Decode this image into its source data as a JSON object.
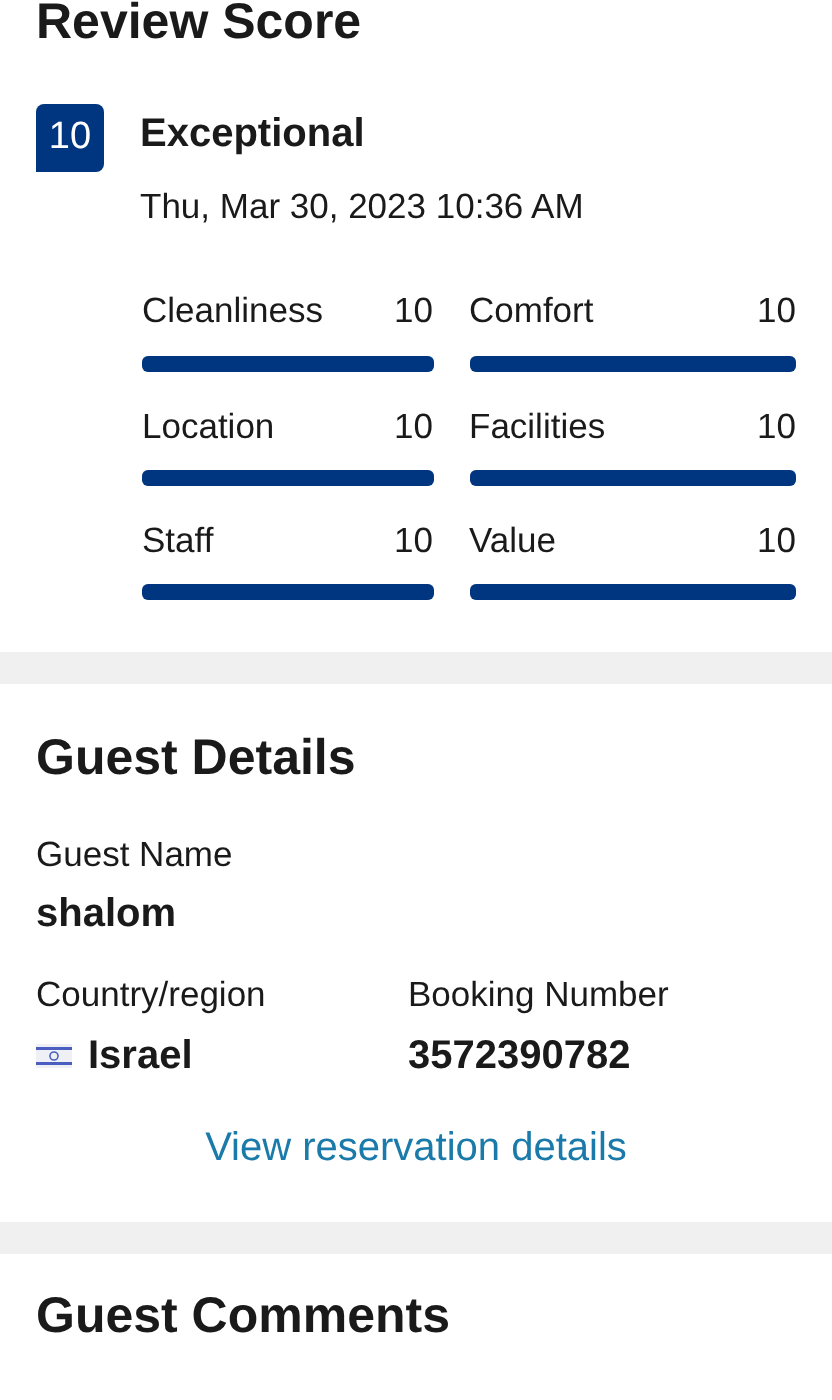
{
  "review_score": {
    "title": "Review Score",
    "score": "10",
    "rating": "Exceptional",
    "date": "Thu, Mar 30, 2023 10:36 AM",
    "categories": [
      {
        "name": "Cleanliness",
        "score": "10",
        "level": 1
      },
      {
        "name": "Comfort",
        "score": "10",
        "level": 1
      },
      {
        "name": "Location",
        "score": "10",
        "level": 1
      },
      {
        "name": "Facilities",
        "score": "10",
        "level": 1
      },
      {
        "name": "Staff",
        "score": "10",
        "level": 1
      },
      {
        "name": "Value",
        "score": "10",
        "level": 1
      }
    ]
  },
  "guest_details": {
    "title": "Guest Details",
    "guest_name_label": "Guest Name",
    "guest_name": "shalom",
    "country_label": "Country/region",
    "country": "Israel",
    "booking_label": "Booking Number",
    "booking_number": "3572390782",
    "link": "View reservation details"
  },
  "guest_comments": {
    "title": "Guest Comments"
  }
}
